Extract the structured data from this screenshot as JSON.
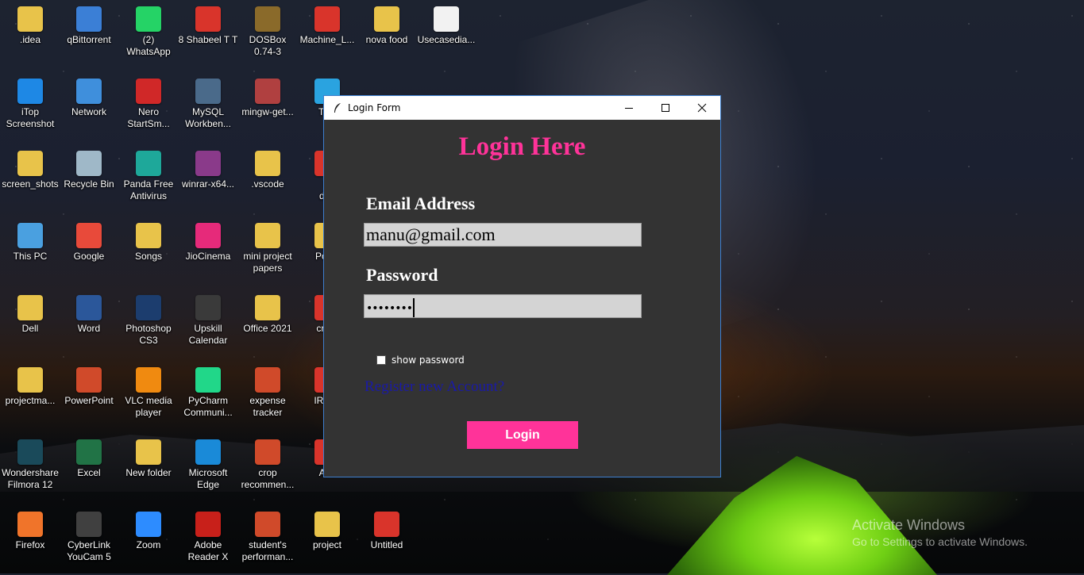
{
  "desktop": {
    "icons": [
      {
        "label": ".idea",
        "icon": "folder-icon",
        "color": "#e8c34a"
      },
      {
        "label": "qBittorrent",
        "icon": "qbittorrent-icon",
        "color": "#3b7fd6"
      },
      {
        "label": "(2)\nWhatsApp",
        "icon": "whatsapp-icon",
        "color": "#25d366"
      },
      {
        "label": "8 Shabeel T T",
        "icon": "pdf-icon",
        "color": "#d9342b"
      },
      {
        "label": "DOSBox\n0.74-3",
        "icon": "dosbox-icon",
        "color": "#8a6a2a"
      },
      {
        "label": "Machine_L...",
        "icon": "pdf-icon",
        "color": "#d9342b"
      },
      {
        "label": "nova food",
        "icon": "folder-icon",
        "color": "#e8c34a"
      },
      {
        "label": "Usecasedia...",
        "icon": "file-icon",
        "color": "#f2f2f2"
      },
      {
        "label": "iTop\nScreenshot",
        "icon": "camera-icon",
        "color": "#1e88e5"
      },
      {
        "label": "Network",
        "icon": "network-icon",
        "color": "#3f8fdc"
      },
      {
        "label": "Nero\nStartSm...",
        "icon": "nero-icon",
        "color": "#d02828"
      },
      {
        "label": "MySQL\nWorkben...",
        "icon": "mysql-icon",
        "color": "#4a6a8a"
      },
      {
        "label": "mingw-get...",
        "icon": "installer-icon",
        "color": "#b04040"
      },
      {
        "label": "Tele",
        "icon": "telegram-icon",
        "color": "#2aa3e0"
      },
      {
        "label": "screen_shots",
        "icon": "folder-icon",
        "color": "#e8c34a"
      },
      {
        "label": "Recycle Bin",
        "icon": "recycle-bin-icon",
        "color": "#9fb8c8"
      },
      {
        "label": "Panda Free\nAntivirus",
        "icon": "panda-icon",
        "color": "#1ea89a"
      },
      {
        "label": "winrar-x64...",
        "icon": "winrar-icon",
        "color": "#8a3a8a"
      },
      {
        "label": ".vscode",
        "icon": "folder-icon",
        "color": "#e8c34a"
      },
      {
        "label": "bl\ndon",
        "icon": "pdf-icon",
        "color": "#d9342b"
      },
      {
        "label": "This PC",
        "icon": "computer-icon",
        "color": "#4aa0e0"
      },
      {
        "label": "Google",
        "icon": "chrome-icon",
        "color": "#e84a3a"
      },
      {
        "label": "Songs",
        "icon": "folder-icon",
        "color": "#e8c34a"
      },
      {
        "label": "JioCinema",
        "icon": "jiocinema-icon",
        "color": "#e62a7a"
      },
      {
        "label": "mini project\npapers",
        "icon": "folder-icon",
        "color": "#e8c34a"
      },
      {
        "label": "Powe",
        "icon": "folder-icon",
        "color": "#e8c34a"
      },
      {
        "label": "Dell",
        "icon": "user-folder-icon",
        "color": "#e8c34a"
      },
      {
        "label": "Word",
        "icon": "word-icon",
        "color": "#2b579a"
      },
      {
        "label": "Photoshop\nCS3",
        "icon": "photoshop-icon",
        "color": "#1c3d6e"
      },
      {
        "label": "Upskill\nCalendar",
        "icon": "upskill-icon",
        "color": "#3a3a3a"
      },
      {
        "label": "Office 2021",
        "icon": "folder-icon",
        "color": "#e8c34a"
      },
      {
        "label": "crop-",
        "icon": "pdf-icon",
        "color": "#d9342b"
      },
      {
        "label": "projectma...",
        "icon": "folder-icon",
        "color": "#e8c34a"
      },
      {
        "label": "PowerPoint",
        "icon": "powerpoint-icon",
        "color": "#d04a2a"
      },
      {
        "label": "VLC media\nplayer",
        "icon": "vlc-icon",
        "color": "#f08a10"
      },
      {
        "label": "PyCharm\nCommuni...",
        "icon": "pycharm-icon",
        "color": "#21d789"
      },
      {
        "label": "expense\ntracker",
        "icon": "powerpoint-file-icon",
        "color": "#d04a2a"
      },
      {
        "label": "IRJET",
        "icon": "pdf-icon",
        "color": "#d9342b"
      },
      {
        "label": "Wondershare\nFilmora 12",
        "icon": "filmora-icon",
        "color": "#1a4a5a"
      },
      {
        "label": "Excel",
        "icon": "excel-icon",
        "color": "#217346"
      },
      {
        "label": "New folder",
        "icon": "folder-icon",
        "color": "#e8c34a"
      },
      {
        "label": "Microsoft\nEdge",
        "icon": "edge-icon",
        "color": "#1a8ad8"
      },
      {
        "label": "crop\nrecommen...",
        "icon": "powerpoint-file-icon",
        "color": "#d04a2a"
      },
      {
        "label": "Abs",
        "icon": "pdf-icon",
        "color": "#d9342b"
      },
      {
        "label": "Firefox",
        "icon": "firefox-icon",
        "color": "#f0742a"
      },
      {
        "label": "CyberLink\nYouCam 5",
        "icon": "youcam-icon",
        "color": "#404040"
      },
      {
        "label": "Zoom",
        "icon": "zoom-icon",
        "color": "#2d8cff"
      },
      {
        "label": "Adobe\nReader X",
        "icon": "adobe-reader-icon",
        "color": "#c8201a"
      },
      {
        "label": "student's\nperforman...",
        "icon": "powerpoint-file-icon",
        "color": "#d04a2a"
      },
      {
        "label": "project",
        "icon": "folder-icon",
        "color": "#e8c34a"
      },
      {
        "label": "Untitled",
        "icon": "pdf-icon",
        "color": "#d9342b"
      }
    ],
    "activate": {
      "line1": "Activate Windows",
      "line2": "Go to Settings to activate Windows."
    }
  },
  "window": {
    "title": "Login Form",
    "heading": "Login Here",
    "email_label": "Email Address",
    "email_value": "manu@gmail.com",
    "password_label": "Password",
    "password_value": "••••••••",
    "show_password_label": "show password",
    "show_password_checked": false,
    "register_link": "Register new Account?",
    "login_button": "Login",
    "colors": {
      "accent": "#ff3399",
      "background": "#333333",
      "link": "#1a1aa6"
    }
  }
}
